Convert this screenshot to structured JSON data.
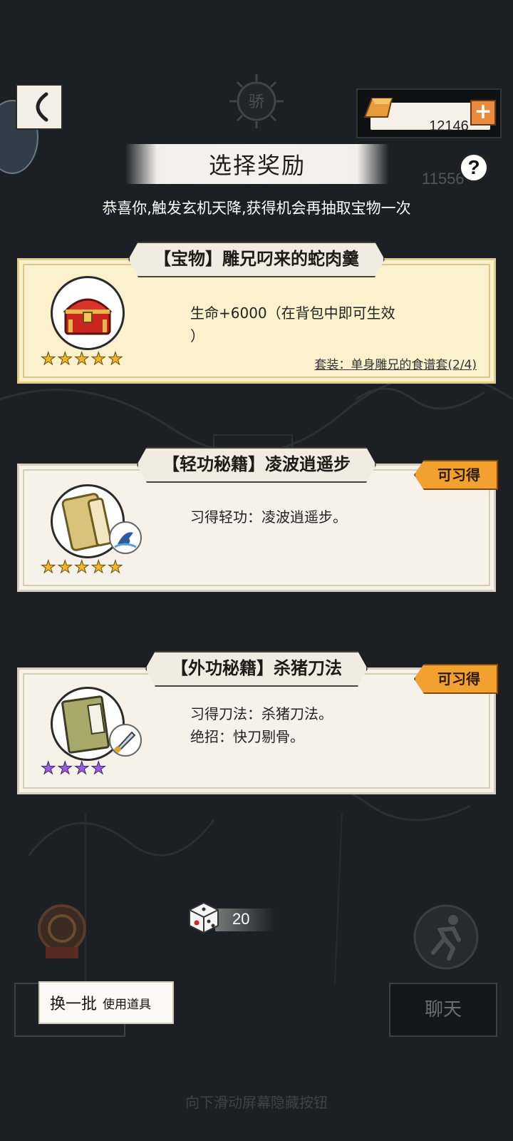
{
  "header": {
    "currency_value": "12146",
    "title": "选择奖励",
    "ghost_count": "11556",
    "subtitle": "恭喜你,触发玄机天降,获得机会再抽取宝物一次"
  },
  "cards": [
    {
      "title": "【宝物】雕兄叼来的蛇肉羹",
      "description": "生命+6000（在背包中即可生效\n）",
      "set_text": "套装：单身雕兄的食谱套(2/4)",
      "stars": 5,
      "star_color": "#f0b726",
      "icon": "treasure-chest-icon"
    },
    {
      "title": "【轻功秘籍】凌波逍遥步",
      "description": "习得轻功：凌波逍遥步。",
      "badge": "可习得",
      "stars": 5,
      "star_color": "#f0b726",
      "icon": "scroll-icon"
    },
    {
      "title": "【外功秘籍】杀猪刀法",
      "description": "习得刀法：杀猪刀法。\n绝招：快刀剔骨。",
      "badge": "可习得",
      "stars": 4,
      "star_color": "#9a5fe0",
      "icon": "manual-book-icon"
    }
  ],
  "bottom": {
    "dice_count": "20",
    "refresh_label": "换一批",
    "use_item_label": "使用道具",
    "chat_label": "聊天",
    "hint": "向下滑动屏幕隐藏按钮"
  }
}
